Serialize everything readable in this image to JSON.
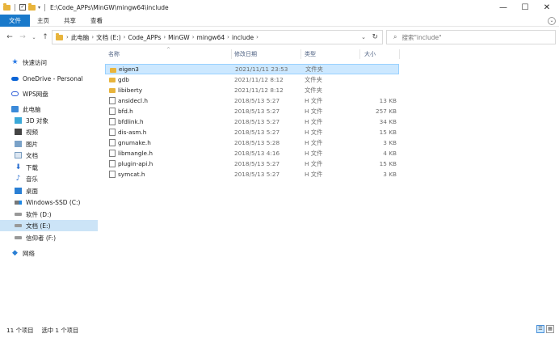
{
  "title_bar": {
    "path": "E:\\Code_APPs\\MinGW\\mingw64\\include",
    "minimize": "—",
    "maximize": "☐",
    "close": "✕"
  },
  "ribbon": {
    "tabs": [
      "文件",
      "主页",
      "共享",
      "查看"
    ],
    "expand": "⌄"
  },
  "nav_buttons": {
    "back": "←",
    "forward": "→",
    "recent": "⌄",
    "up": "↑"
  },
  "address": {
    "crumbs": [
      "此电脑",
      "文档 (E:)",
      "Code_APPs",
      "MinGW",
      "mingw64",
      "include"
    ],
    "dropdown": "⌄",
    "refresh": "↻"
  },
  "search": {
    "placeholder": "搜索\"include\"",
    "icon": "search-icon"
  },
  "nav_pane": [
    {
      "label": "快速访问",
      "icon": "star-icon"
    },
    {
      "label": "OneDrive - Personal",
      "icon": "cloud-icon"
    },
    {
      "label": "WPS网盘",
      "icon": "cloud-outline-icon"
    },
    {
      "label": "此电脑",
      "icon": "computer-icon"
    },
    {
      "label": "3D 对象",
      "icon": "cube-icon"
    },
    {
      "label": "视频",
      "icon": "video-icon"
    },
    {
      "label": "图片",
      "icon": "picture-icon"
    },
    {
      "label": "文档",
      "icon": "document-icon"
    },
    {
      "label": "下载",
      "icon": "download-icon"
    },
    {
      "label": "音乐",
      "icon": "music-icon"
    },
    {
      "label": "桌面",
      "icon": "desktop-icon"
    },
    {
      "label": "Windows-SSD (C:)",
      "icon": "windows-drive-icon"
    },
    {
      "label": "软件 (D:)",
      "icon": "drive-icon"
    },
    {
      "label": "文档 (E:)",
      "icon": "drive-icon",
      "selected": true
    },
    {
      "label": "信仰者 (F:)",
      "icon": "drive-icon"
    },
    {
      "label": "网络",
      "icon": "network-icon"
    }
  ],
  "columns": {
    "name": "名称",
    "date": "修改日期",
    "type": "类型",
    "size": "大小"
  },
  "files": [
    {
      "name": "eigen3",
      "date": "2021/11/11 23:53",
      "type": "文件夹",
      "size": "",
      "kind": "folder",
      "selected": true
    },
    {
      "name": "gdb",
      "date": "2021/11/12 8:12",
      "type": "文件夹",
      "size": "",
      "kind": "folder"
    },
    {
      "name": "libiberty",
      "date": "2021/11/12 8:12",
      "type": "文件夹",
      "size": "",
      "kind": "folder"
    },
    {
      "name": "ansidecl.h",
      "date": "2018/5/13 5:27",
      "type": "H 文件",
      "size": "13 KB",
      "kind": "file"
    },
    {
      "name": "bfd.h",
      "date": "2018/5/13 5:27",
      "type": "H 文件",
      "size": "257 KB",
      "kind": "file"
    },
    {
      "name": "bfdlink.h",
      "date": "2018/5/13 5:27",
      "type": "H 文件",
      "size": "34 KB",
      "kind": "file"
    },
    {
      "name": "dis-asm.h",
      "date": "2018/5/13 5:27",
      "type": "H 文件",
      "size": "15 KB",
      "kind": "file"
    },
    {
      "name": "gnumake.h",
      "date": "2018/5/13 5:28",
      "type": "H 文件",
      "size": "3 KB",
      "kind": "file"
    },
    {
      "name": "libmangle.h",
      "date": "2018/5/13 4:16",
      "type": "H 文件",
      "size": "4 KB",
      "kind": "file"
    },
    {
      "name": "plugin-api.h",
      "date": "2018/5/13 5:27",
      "type": "H 文件",
      "size": "15 KB",
      "kind": "file"
    },
    {
      "name": "symcat.h",
      "date": "2018/5/13 5:27",
      "type": "H 文件",
      "size": "3 KB",
      "kind": "file"
    }
  ],
  "status": {
    "item_count": "11 个项目",
    "selected": "选中 1 个项目"
  },
  "colors": {
    "file_tab": "#1979ca",
    "selection": "#cce8ff",
    "folder": "#e8b43c"
  }
}
